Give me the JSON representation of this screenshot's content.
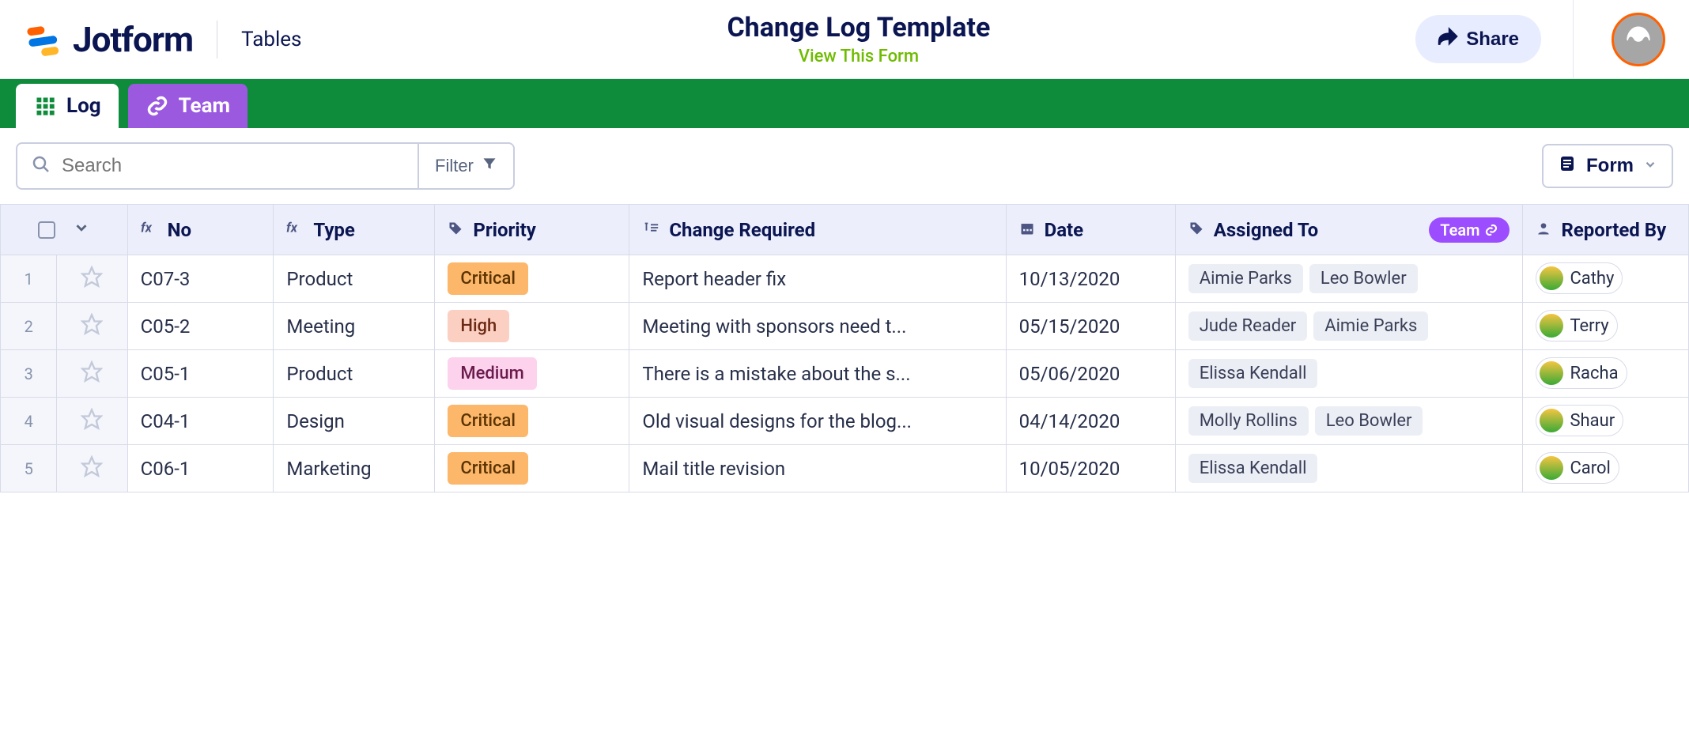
{
  "header": {
    "brand_name": "Jotform",
    "section": "Tables",
    "title": "Change Log Template",
    "view_link": "View This Form",
    "share_label": "Share"
  },
  "tabs": [
    {
      "label": "Log",
      "active": true
    },
    {
      "label": "Team",
      "active": false
    }
  ],
  "toolbar": {
    "search_placeholder": "Search",
    "filter_label": "Filter",
    "form_view_label": "Form"
  },
  "columns": {
    "no": "No",
    "type": "Type",
    "priority": "Priority",
    "change_required": "Change Required",
    "date": "Date",
    "assigned_to": "Assigned To",
    "team_badge": "Team",
    "reported_by": "Reported By"
  },
  "rows": [
    {
      "idx": "1",
      "no": "C07-3",
      "type": "Product",
      "priority": "Critical",
      "priority_class": "critical",
      "change": "Report header fix",
      "date": "10/13/2020",
      "assigned": [
        "Aimie Parks",
        "Leo Bowler"
      ],
      "reported": "Cathy"
    },
    {
      "idx": "2",
      "no": "C05-2",
      "type": "Meeting",
      "priority": "High",
      "priority_class": "high",
      "change": "Meeting with sponsors need t...",
      "date": "05/15/2020",
      "assigned": [
        "Jude Reader",
        "Aimie Parks"
      ],
      "reported": "Terry"
    },
    {
      "idx": "3",
      "no": "C05-1",
      "type": "Product",
      "priority": "Medium",
      "priority_class": "medium",
      "change": "There is a mistake about the s...",
      "date": "05/06/2020",
      "assigned": [
        "Elissa Kendall"
      ],
      "reported": "Racha"
    },
    {
      "idx": "4",
      "no": "C04-1",
      "type": "Design",
      "priority": "Critical",
      "priority_class": "critical",
      "change": "Old visual designs for the blog...",
      "date": "04/14/2020",
      "assigned": [
        "Molly Rollins",
        "Leo Bowler"
      ],
      "reported": "Shaur"
    },
    {
      "idx": "5",
      "no": "C06-1",
      "type": "Marketing",
      "priority": "Critical",
      "priority_class": "critical",
      "change": "Mail title revision",
      "date": "10/05/2020",
      "assigned": [
        "Elissa Kendall"
      ],
      "reported": "Carol"
    }
  ]
}
